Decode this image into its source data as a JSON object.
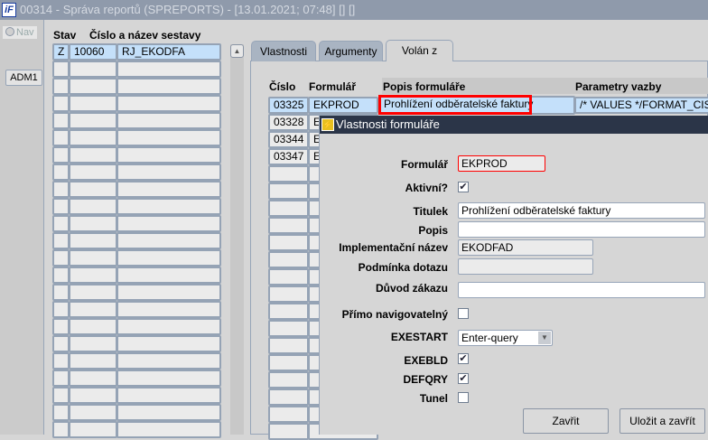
{
  "window": {
    "title": "00314 - Správa reportů (SPREPORTS) - [13.01.2021; 07:48]  [] []",
    "logo": "iF"
  },
  "left": {
    "nav_label": "Nav",
    "adm_button": "ADM1"
  },
  "reports": {
    "headers": {
      "stav": "Stav",
      "nazev": "Číslo a název sestavy"
    },
    "rows": [
      {
        "stav": "Z",
        "cislo": "10060",
        "nazev": "RJ_EKODFA"
      }
    ],
    "empty_rows": 22
  },
  "tabs": [
    {
      "label": "Vlastnosti"
    },
    {
      "label": "Argumenty"
    },
    {
      "label": "Volán z",
      "active": true
    }
  ],
  "called_from": {
    "headers": {
      "cislo": "Číslo",
      "formular": "Formulář",
      "popis": "Popis formuláře",
      "parametry": "Parametry vazby"
    },
    "rows": [
      {
        "cislo": "03325",
        "formular": "EKPROD",
        "popis": "Prohlížení odběratelské faktury",
        "parametry": "/* VALUES */FORMAT_CISLA:"
      },
      {
        "cislo": "03328",
        "formular": "E"
      },
      {
        "cislo": "03344",
        "formular": "E"
      },
      {
        "cislo": "03347",
        "formular": "E"
      }
    ]
  },
  "dialog": {
    "title": "Vlastnosti formuláře",
    "formular_label": "Formulář",
    "formular": "EKPROD",
    "aktivni_label": "Aktivní?",
    "aktivni": true,
    "titulek_label": "Titulek",
    "titulek": "Prohlížení odběratelské faktury",
    "popis_label": "Popis",
    "popis": "",
    "impl_label": "Implementační název",
    "impl": "EKODFAD",
    "podminka_label": "Podmínka dotazu",
    "podminka": "",
    "duvod_label": "Důvod zákazu",
    "duvod": "",
    "primo_label": "Přímo navigovatelný",
    "primo": false,
    "exestart_label": "EXESTART",
    "exestart": "Enter-query",
    "exebld_label": "EXEBLD",
    "exebld": true,
    "defqry_label": "DEFQRY",
    "defqry": true,
    "tunel_label": "Tunel",
    "tunel": false,
    "close_button": "Zavřit",
    "save_close_button": "Uložit a zavřít"
  },
  "colors": {
    "highlight": "#ff0000",
    "selected": "#c4e0fa",
    "titlebar": "#2b3548"
  }
}
